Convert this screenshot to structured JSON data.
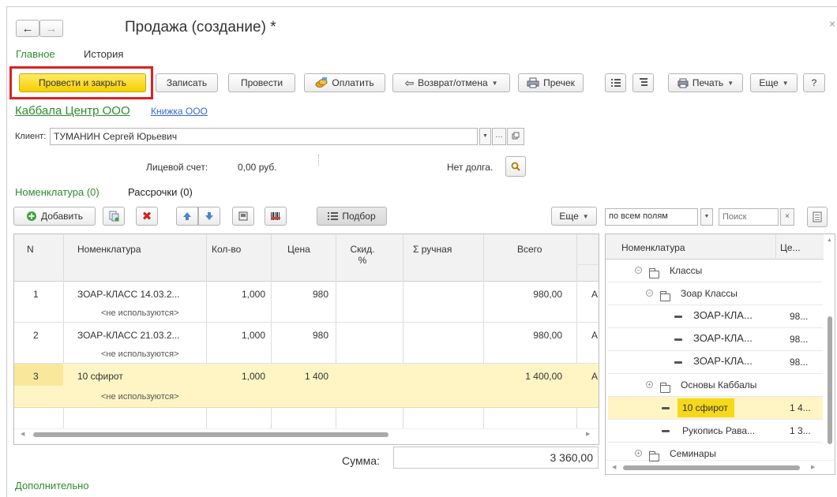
{
  "window": {
    "title": "Продажа (создание) *",
    "close_glyph": "×"
  },
  "tabs": [
    {
      "label": "Главное",
      "active": true
    },
    {
      "label": "История",
      "active": false
    }
  ],
  "toolbar": {
    "post_close": "Провести и закрыть",
    "save": "Записать",
    "post": "Провести",
    "pay": "Оплатить",
    "return": "Возврат/отмена",
    "precheck": "Пречек",
    "print": "Печать",
    "more": "Еще",
    "help": "?"
  },
  "company": {
    "name": "Каббала Центр ООО",
    "book": "Книжка ООО"
  },
  "client": {
    "label": "Клиент:",
    "value": "ТУМАНИН Сергей Юрьевич"
  },
  "account": {
    "label": "Лицевой счет:",
    "value": "0,00 руб.",
    "debt": "Нет долга."
  },
  "section_tabs": [
    {
      "label": "Номенклатура (0)",
      "active": false
    },
    {
      "label": "Рассрочки (0)",
      "active": true
    }
  ],
  "table_toolbar": {
    "add": "Добавить",
    "pick": "Подбор",
    "more": "Еще"
  },
  "table": {
    "columns": [
      "N",
      "Номенклатура",
      "Кол-во",
      "Цена",
      "Скид. %",
      "Σ ручная",
      "Всего"
    ],
    "rows": [
      {
        "n": "1",
        "name": "ЗОАР-КЛАСС 14.03.2...",
        "sub": "<не используются>",
        "qty": "1,000",
        "price": "980",
        "discount": "",
        "manual": "",
        "total": "980,00",
        "extra": "А",
        "selected": false
      },
      {
        "n": "2",
        "name": "ЗОАР-КЛАСС 21.03.2...",
        "sub": "<не используются>",
        "qty": "1,000",
        "price": "980",
        "discount": "",
        "manual": "",
        "total": "980,00",
        "extra": "А",
        "selected": false
      },
      {
        "n": "3",
        "name": "10 сфирот",
        "sub": "<не используются>",
        "qty": "1,000",
        "price": "1 400",
        "discount": "",
        "manual": "",
        "total": "1 400,00",
        "extra": "А",
        "selected": true
      }
    ]
  },
  "sum": {
    "label": "Сумма:",
    "value": "3 360,00"
  },
  "footer": {
    "additional": "Дополнительно"
  },
  "search": {
    "mode": "по всем полям",
    "placeholder": "Поиск"
  },
  "tree": {
    "columns": [
      "Номенклатура",
      "Це..."
    ],
    "rows": [
      {
        "type": "folder",
        "expanded": true,
        "level": 0,
        "label": "Классы",
        "price": ""
      },
      {
        "type": "folder",
        "expanded": true,
        "level": 1,
        "label": "Зоар Классы",
        "price": ""
      },
      {
        "type": "item",
        "level": 2,
        "label": "ЗОАР-КЛА...",
        "price": "98..."
      },
      {
        "type": "item",
        "level": 2,
        "label": "ЗОАР-КЛА...",
        "price": "98..."
      },
      {
        "type": "item",
        "level": 2,
        "label": "ЗОАР-КЛА...",
        "price": "98..."
      },
      {
        "type": "folder",
        "expanded": false,
        "level": 1,
        "label": "Основы Каббалы",
        "price": ""
      },
      {
        "type": "item",
        "level": 1,
        "label": "10 сфирот",
        "price": "1 4...",
        "selected": true
      },
      {
        "type": "item",
        "level": 1,
        "label": "Рукопись Рава...",
        "price": "1 3..."
      },
      {
        "type": "folder",
        "expanded": false,
        "level": 0,
        "label": "Семинары",
        "price": ""
      }
    ]
  },
  "colors": {
    "accent_green": "#2e8b2e",
    "highlight_yellow": "#fff5c4",
    "button_yellow": "#f5cf00",
    "focus_red": "#e02020"
  }
}
